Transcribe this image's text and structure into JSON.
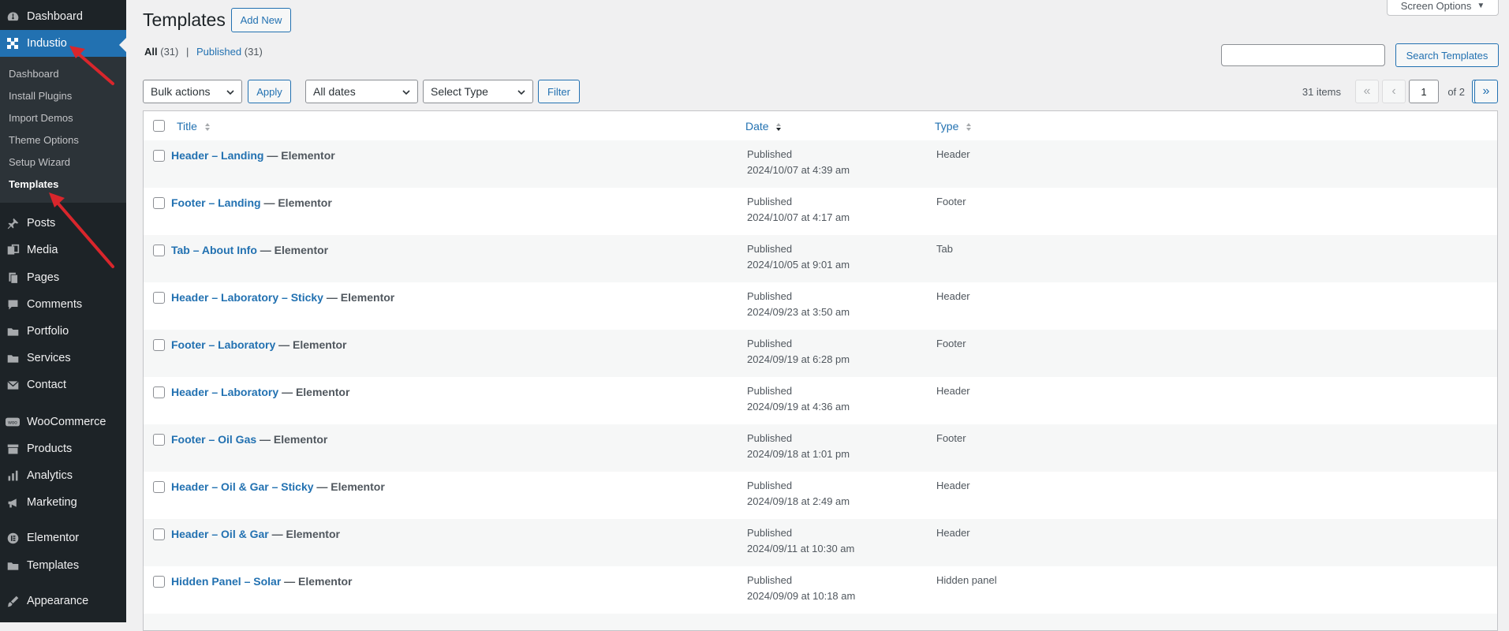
{
  "sidebar": {
    "top_items": [
      {
        "label": "Dashboard",
        "icon": "dashboard-icon"
      },
      {
        "label": "Industio",
        "icon": "industio-logo-icon"
      }
    ],
    "submenu": [
      "Dashboard",
      "Install Plugins",
      "Import Demos",
      "Theme Options",
      "Setup Wizard",
      "Templates"
    ],
    "items": [
      {
        "label": "Posts",
        "icon": "pin-icon"
      },
      {
        "label": "Media",
        "icon": "media-icon"
      },
      {
        "label": "Pages",
        "icon": "pages-icon"
      },
      {
        "label": "Comments",
        "icon": "comments-icon"
      },
      {
        "label": "Portfolio",
        "icon": "folder-icon"
      },
      {
        "label": "Services",
        "icon": "folder-icon"
      },
      {
        "label": "Contact",
        "icon": "mail-icon"
      },
      {
        "label": "WooCommerce",
        "icon": "woo-icon"
      },
      {
        "label": "Products",
        "icon": "archive-icon"
      },
      {
        "label": "Analytics",
        "icon": "chart-bar-icon"
      },
      {
        "label": "Marketing",
        "icon": "megaphone-icon"
      },
      {
        "label": "Elementor",
        "icon": "elementor-icon"
      },
      {
        "label": "Templates",
        "icon": "folder-icon"
      },
      {
        "label": "Appearance",
        "icon": "brush-icon"
      }
    ]
  },
  "header": {
    "title": "Templates",
    "add_new": "Add New",
    "screen_options": "Screen Options"
  },
  "views": {
    "all_label": "All",
    "all_count": "(31)",
    "separator": "|",
    "published_label": "Published",
    "published_count": "(31)"
  },
  "search": {
    "button": "Search Templates",
    "value": ""
  },
  "filters": {
    "bulk_actions": "Bulk actions",
    "apply": "Apply",
    "dates": "All dates",
    "type": "Select Type",
    "filter": "Filter"
  },
  "pagination": {
    "items": "31 items",
    "first": "«",
    "prev": "‹",
    "current_page": "1",
    "of_total": "of 2",
    "next": "›",
    "last": "»"
  },
  "table": {
    "columns": {
      "title": "Title",
      "date": "Date",
      "type": "Type"
    },
    "rows": [
      {
        "title": "Header – Landing",
        "suffix": "— Elementor",
        "status": "Published",
        "date": "2024/10/07 at 4:39 am",
        "type": "Header"
      },
      {
        "title": "Footer – Landing",
        "suffix": "— Elementor",
        "status": "Published",
        "date": "2024/10/07 at 4:17 am",
        "type": "Footer"
      },
      {
        "title": "Tab – About Info",
        "suffix": "— Elementor",
        "status": "Published",
        "date": "2024/10/05 at 9:01 am",
        "type": "Tab"
      },
      {
        "title": "Header – Laboratory – Sticky",
        "suffix": "— Elementor",
        "status": "Published",
        "date": "2024/09/23 at 3:50 am",
        "type": "Header"
      },
      {
        "title": "Footer – Laboratory",
        "suffix": "— Elementor",
        "status": "Published",
        "date": "2024/09/19 at 6:28 pm",
        "type": "Footer"
      },
      {
        "title": "Header – Laboratory",
        "suffix": "— Elementor",
        "status": "Published",
        "date": "2024/09/19 at 4:36 am",
        "type": "Header"
      },
      {
        "title": "Footer – Oil Gas",
        "suffix": "— Elementor",
        "status": "Published",
        "date": "2024/09/18 at 1:01 pm",
        "type": "Footer"
      },
      {
        "title": "Header – Oil & Gar – Sticky",
        "suffix": "— Elementor",
        "status": "Published",
        "date": "2024/09/18 at 2:49 am",
        "type": "Header"
      },
      {
        "title": "Header – Oil & Gar",
        "suffix": "— Elementor",
        "status": "Published",
        "date": "2024/09/11 at 10:30 am",
        "type": "Header"
      },
      {
        "title": "Hidden Panel – Solar",
        "suffix": "— Elementor",
        "status": "Published",
        "date": "2024/09/09 at 10:18 am",
        "type": "Hidden panel"
      }
    ]
  },
  "colors": {
    "accent": "#2271b1",
    "sidebar_bg": "#1d2327",
    "annotation_arrow": "#d9262c"
  }
}
